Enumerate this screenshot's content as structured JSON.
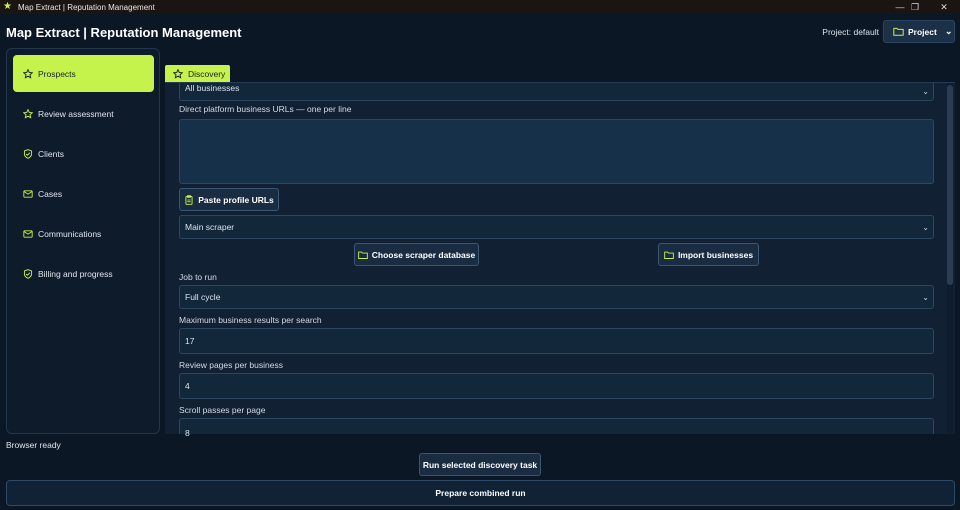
{
  "window": {
    "title": "Map Extract | Reputation Management",
    "controls": {
      "minimize": "—",
      "restore": "❐",
      "close": "✕"
    }
  },
  "header": {
    "app_title": "Map Extract | Reputation Management",
    "project_label": "Project: default",
    "project_button": "Project"
  },
  "sidebar": {
    "items": [
      {
        "label": "Prospects",
        "icon": "star-icon",
        "active": true
      },
      {
        "label": "Review assessment",
        "icon": "star-icon",
        "active": false
      },
      {
        "label": "Clients",
        "icon": "shield-check-icon",
        "active": false
      },
      {
        "label": "Cases",
        "icon": "mail-check-icon",
        "active": false
      },
      {
        "label": "Communications",
        "icon": "mail-check-icon",
        "active": false
      },
      {
        "label": "Billing and progress",
        "icon": "shield-check-icon",
        "active": false
      }
    ]
  },
  "tabs": [
    {
      "label": "Discovery",
      "icon": "star-icon"
    }
  ],
  "form": {
    "filter_select": "All businesses",
    "urls_label": "Direct platform business URLs — one per line",
    "urls_value": "",
    "paste_button": "Paste profile URLs",
    "scraper_select": "Main scraper",
    "choose_db_button": "Choose scraper database",
    "import_button": "Import businesses",
    "job_label": "Job to run",
    "job_select": "Full cycle",
    "max_results_label": "Maximum business results per search",
    "max_results_value": "17",
    "review_pages_label": "Review pages per business",
    "review_pages_value": "4",
    "scroll_passes_label": "Scroll passes per page",
    "scroll_passes_value": "8"
  },
  "footer": {
    "status": "Browser ready",
    "run_button": "Run selected discovery task",
    "prepare_button": "Prepare combined run"
  },
  "colors": {
    "accent": "#c6f34b",
    "background": "#0c1726",
    "panel": "#112033",
    "border": "#2e4761"
  }
}
